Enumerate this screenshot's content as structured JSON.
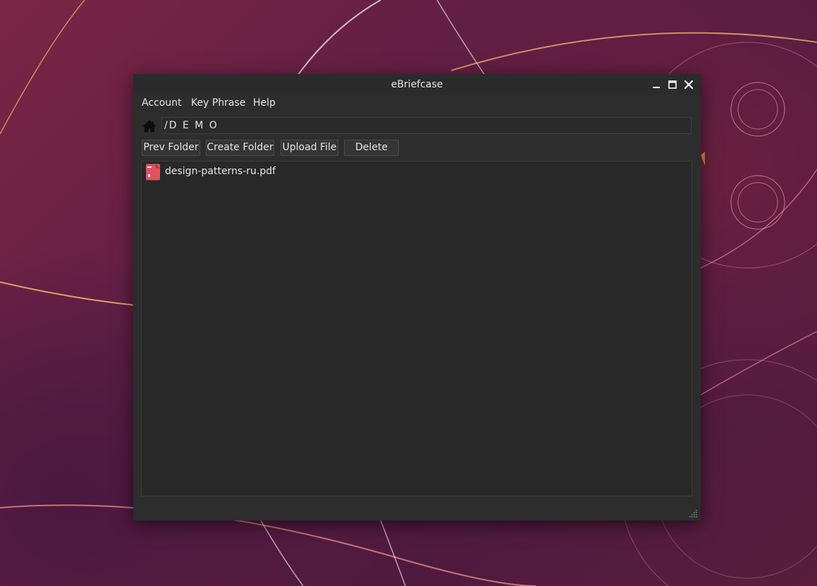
{
  "window": {
    "title": "eBriefcase"
  },
  "menu": {
    "items": [
      {
        "label": "Account"
      },
      {
        "label": "Key Phrase"
      },
      {
        "label": "Help"
      }
    ]
  },
  "path": {
    "value": "/D E M O"
  },
  "toolbar": {
    "prev_folder": "Prev Folder",
    "create_folder": "Create Folder",
    "upload_file": "Upload File",
    "delete": "Delete"
  },
  "files": [
    {
      "name": "design-patterns-ru.pdf",
      "icon": "pdf-file-icon"
    }
  ],
  "colors": {
    "window_bg": "#2d2d2d",
    "list_bg": "#282828",
    "pdf_icon": "#e0525f",
    "text": "#e6e6e6"
  }
}
